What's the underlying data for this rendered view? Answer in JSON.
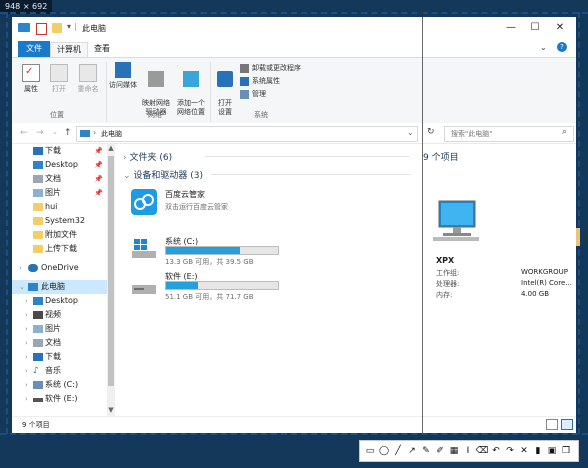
{
  "capture": {
    "size_readout": "948 × 692"
  },
  "window": {
    "title": "此电脑",
    "controls": {
      "minimize": "—",
      "maximize": "☐",
      "close": "✕",
      "help": "?",
      "expand": "⌄"
    }
  },
  "ribbon_tabs": [
    "文件",
    "计算机",
    "查看"
  ],
  "ribbon": {
    "location_group": {
      "label": "位置",
      "items": [
        "属性",
        "打开",
        "重命名"
      ]
    },
    "network_group": {
      "label": "网络",
      "items": [
        "访问媒体",
        "映射网络\n驱动器",
        "添加一个\n网络位置"
      ]
    },
    "system_group": {
      "label": "系统",
      "open_settings": "打开\n设置",
      "small_items": [
        "卸载或更改程序",
        "系统属性",
        "管理"
      ]
    }
  },
  "address": {
    "path": "此电脑",
    "search_placeholder": "搜索\"此电脑\""
  },
  "nav": {
    "quick_access": [
      {
        "label": "下载",
        "pinned": true
      },
      {
        "label": "Desktop",
        "pinned": true
      },
      {
        "label": "文档",
        "pinned": true
      },
      {
        "label": "图片",
        "pinned": true
      },
      {
        "label": "hui",
        "pinned": false
      },
      {
        "label": "System32",
        "pinned": false
      },
      {
        "label": "附加文件",
        "pinned": false
      },
      {
        "label": "上传下载",
        "pinned": false
      }
    ],
    "onedrive": "OneDrive",
    "this_pc": "此电脑",
    "this_pc_children": [
      "Desktop",
      "视频",
      "图片",
      "文档",
      "下载",
      "音乐",
      "系统 (C:)",
      "软件 (E:)"
    ]
  },
  "content": {
    "folders_header": "文件夹 (6)",
    "devices_header": "设备和驱动器 (3)",
    "baidu": {
      "name": "百度云管家",
      "sub": "双击运行百度云管家"
    },
    "drives": [
      {
        "name": "系统 (C:)",
        "free": "13.3 GB 可用，共 39.5 GB",
        "used_fraction": 0.66
      },
      {
        "name": "软件 (E:)",
        "free": "51.1 GB 可用，共 71.7 GB",
        "used_fraction": 0.29
      }
    ]
  },
  "details": {
    "count": "9 个项目",
    "name": "XPX",
    "rows": [
      {
        "key": "工作组:",
        "value": "WORKGROUP"
      },
      {
        "key": "处理器:",
        "value": "Intel(R) Core..."
      },
      {
        "key": "内存:",
        "value": "4.00 GB"
      }
    ]
  },
  "status": {
    "count": "9 个项目"
  },
  "colors": {
    "accent": "#1979ca",
    "capture_bg": "#14385a",
    "drive_fill": "#26a0da"
  },
  "capture_tools": [
    "rectangle-icon",
    "ellipse-icon",
    "line-icon",
    "arrow-icon",
    "pencil-icon",
    "marker-icon",
    "mosaic-icon",
    "text-icon",
    "eraser-icon",
    "undo-icon",
    "redo-icon",
    "cancel-icon",
    "pin-icon",
    "save-icon",
    "copy-icon"
  ],
  "capture_tool_glyphs": [
    "▭",
    "◯",
    "╱",
    "↗",
    "✎",
    "✐",
    "▦",
    "I",
    "⌫",
    "↶",
    "↷",
    "✕",
    "▮",
    "▣",
    "❐"
  ]
}
